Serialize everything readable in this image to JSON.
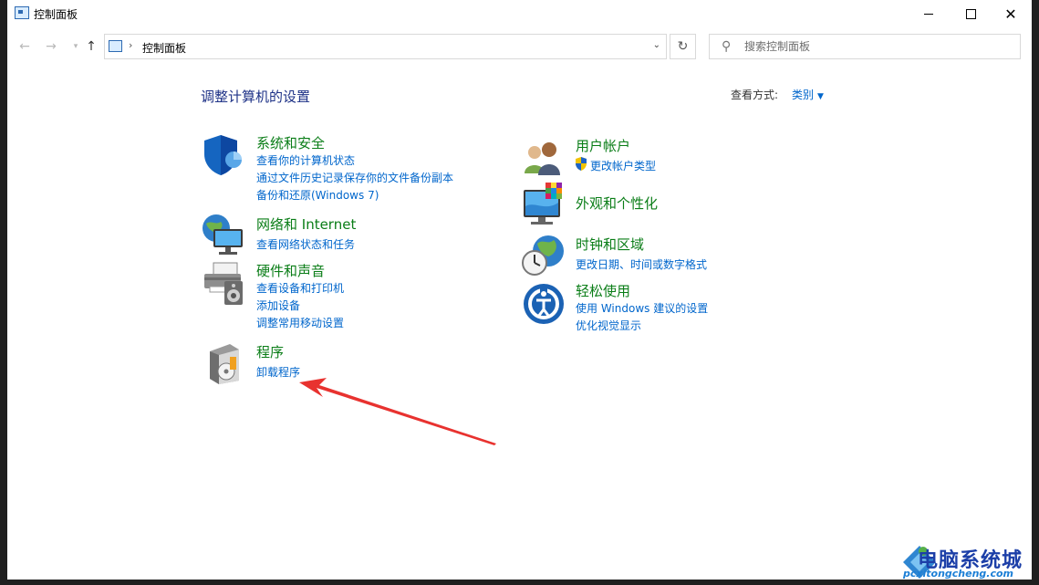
{
  "window": {
    "title": "控制面板"
  },
  "nav": {
    "address_text": "控制面板",
    "search_placeholder": "搜索控制面板"
  },
  "header": {
    "title": "调整计算机的设置",
    "view_by_label": "查看方式:",
    "view_by_value": "类别"
  },
  "categories": {
    "system": {
      "title": "系统和安全",
      "links": [
        "查看你的计算机状态",
        "通过文件历史记录保存你的文件备份副本",
        "备份和还原(Windows 7)"
      ]
    },
    "network": {
      "title": "网络和 Internet",
      "links": [
        "查看网络状态和任务"
      ]
    },
    "hardware": {
      "title": "硬件和声音",
      "links": [
        "查看设备和打印机",
        "添加设备",
        "调整常用移动设置"
      ]
    },
    "programs": {
      "title": "程序",
      "links": [
        "卸载程序"
      ]
    },
    "users": {
      "title": "用户帐户",
      "links": [
        "更改帐户类型"
      ]
    },
    "appearance": {
      "title": "外观和个性化",
      "links": []
    },
    "clock": {
      "title": "时钟和区域",
      "links": [
        "更改日期、时间或数字格式"
      ]
    },
    "ease": {
      "title": "轻松使用",
      "links": [
        "使用 Windows 建议的设置",
        "优化视觉显示"
      ]
    }
  },
  "watermark": {
    "text": "电脑系统城",
    "url": "pcxitongcheng.com"
  },
  "colors": {
    "category_title": "#0a7d17",
    "link": "#0066cc",
    "heading": "#1e3287",
    "annotation_arrow": "#e8322f"
  }
}
